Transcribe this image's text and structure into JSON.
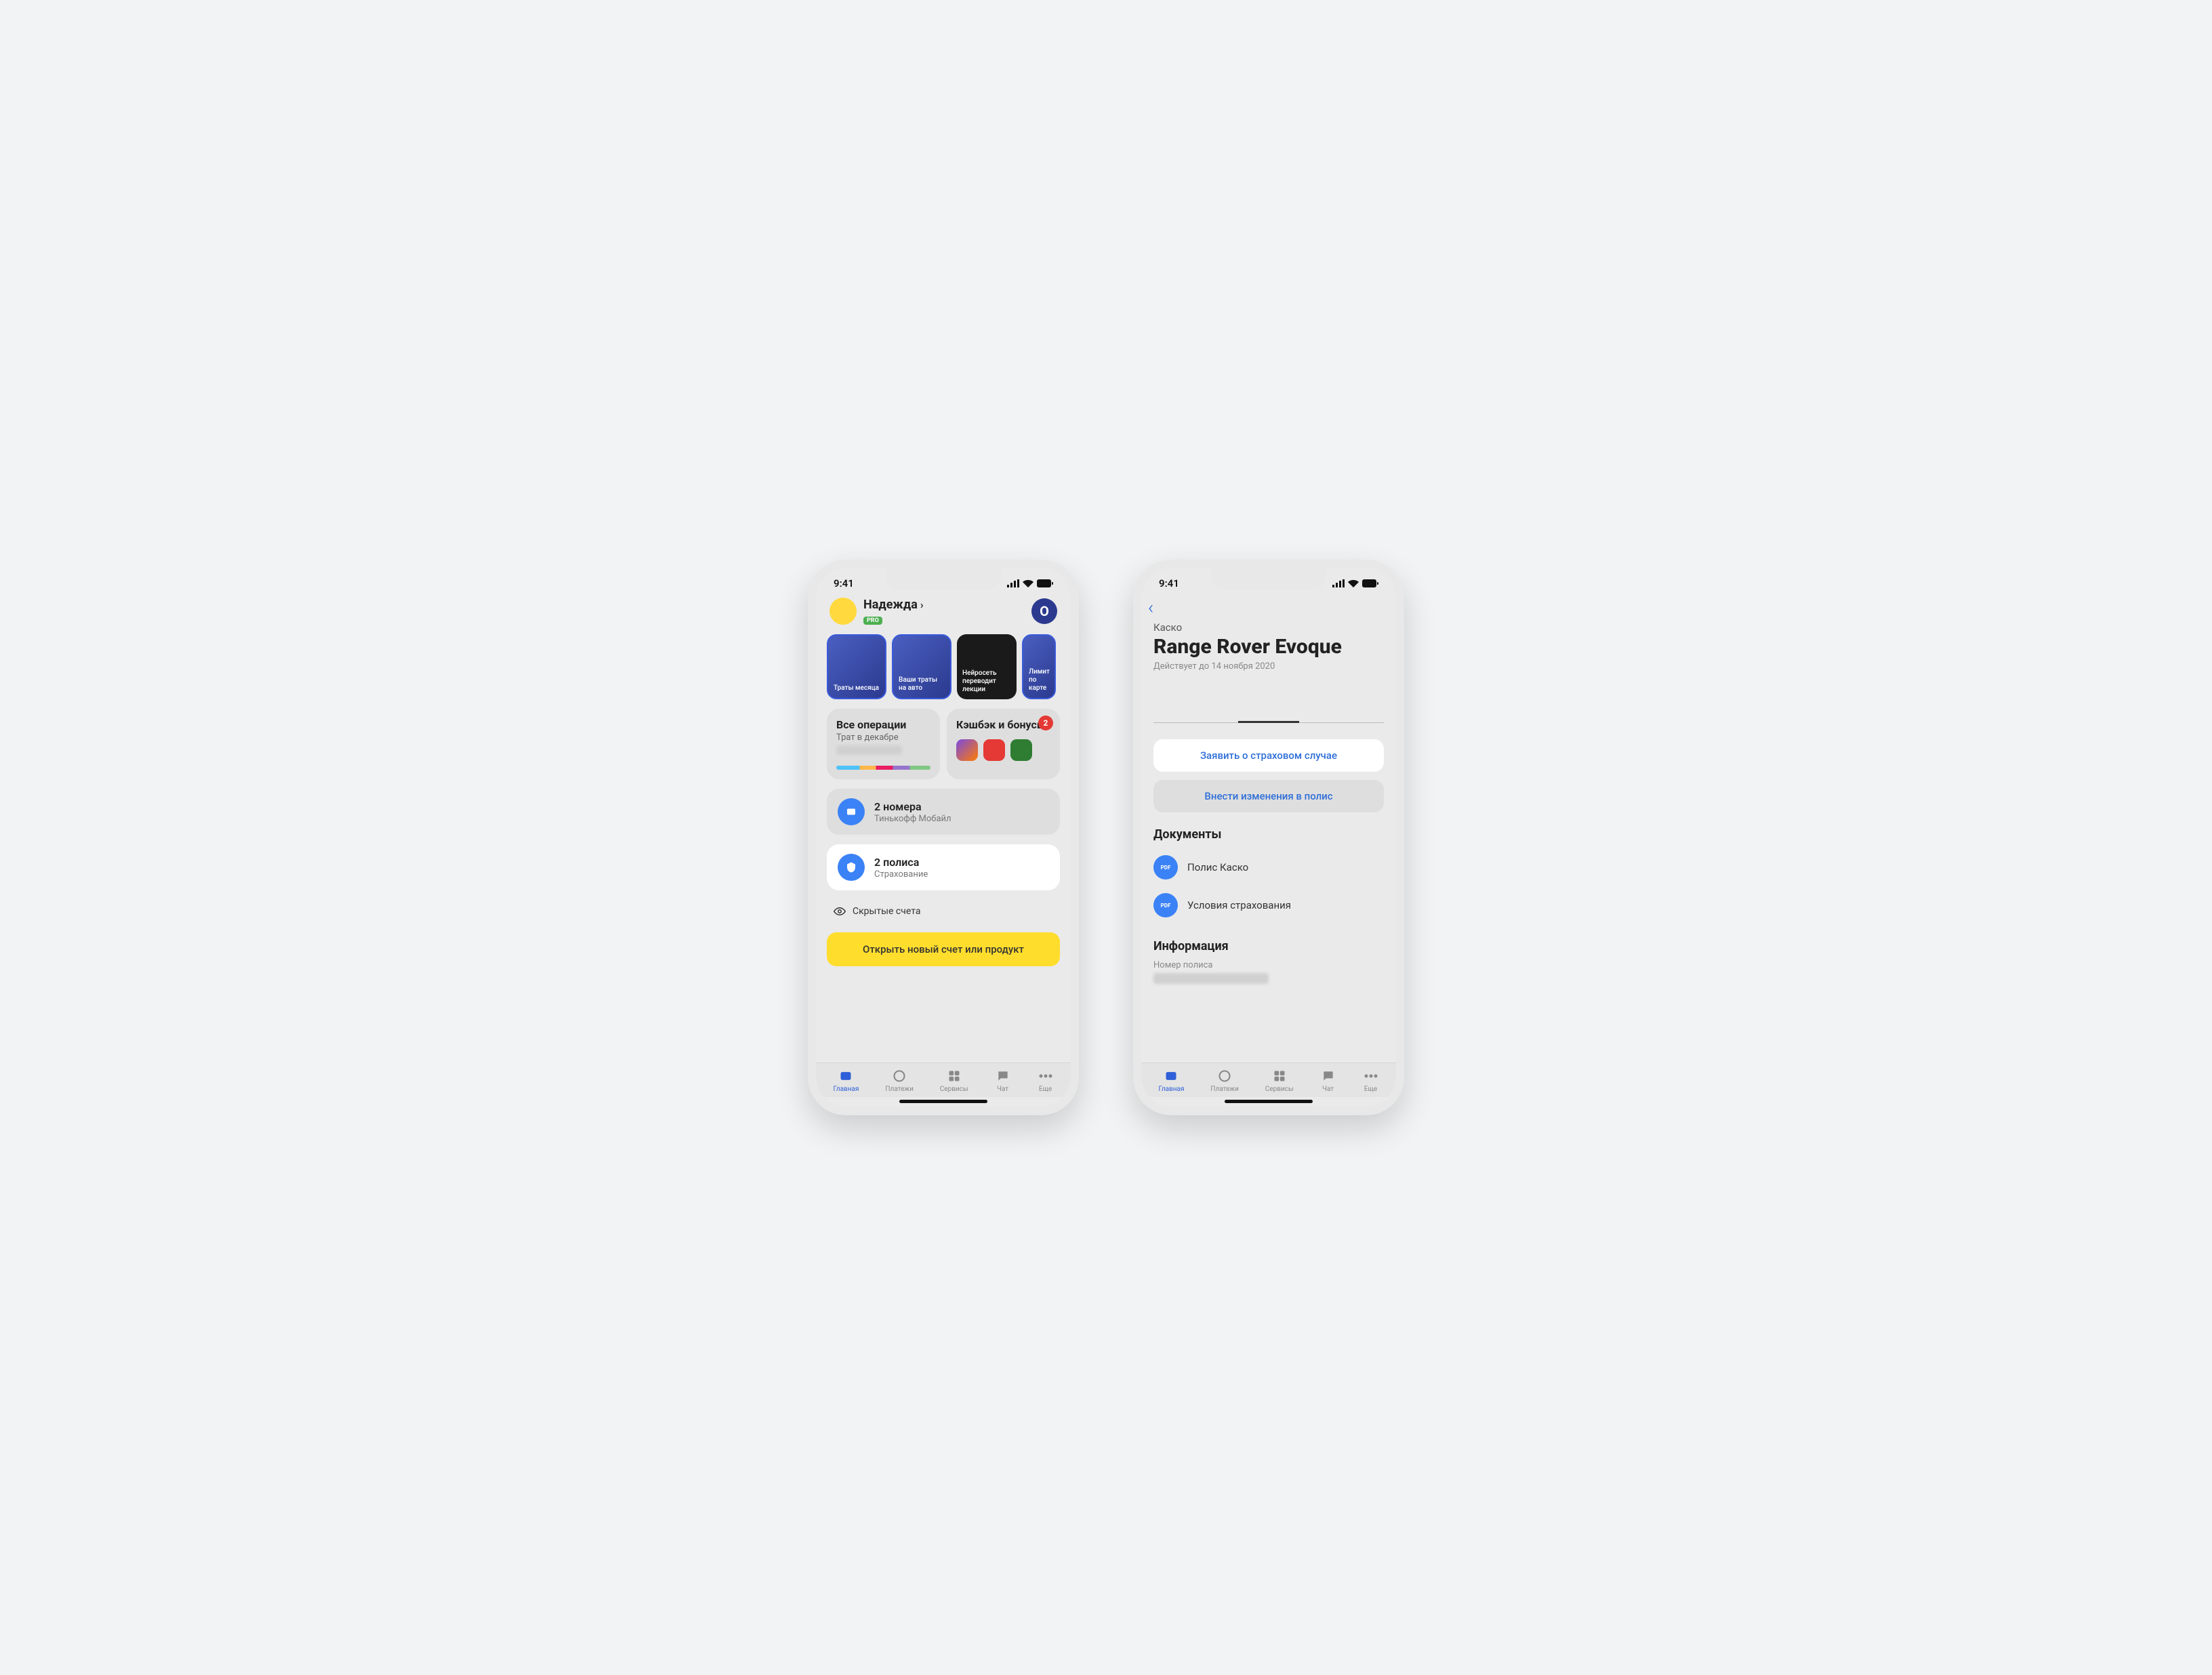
{
  "status_time": "9:41",
  "phone1": {
    "user": {
      "name": "Надежда",
      "badge": "PRO",
      "chevron": "›"
    },
    "logo": "O",
    "stories": [
      {
        "label": "Траты месяца"
      },
      {
        "label": "Ваши траты на авто"
      },
      {
        "label": "Нейросеть переводит лекции"
      },
      {
        "label": "Лимит по карте"
      }
    ],
    "operations": {
      "title": "Все операции",
      "sub": "Трат в декабре"
    },
    "cashback": {
      "title": "Кэшбэк и бонусы",
      "badge": "2"
    },
    "mobile": {
      "title": "2 номера",
      "sub": "Тинькофф Мобайл"
    },
    "insurance": {
      "title": "2 полиса",
      "sub": "Страхование"
    },
    "hidden": "Скрытые счета",
    "open": "Открыть новый счет или продукт"
  },
  "phone2": {
    "label": "Каско",
    "title": "Range Rover Evoque",
    "valid": "Действует до 14 ноября 2020",
    "primary": "Заявить о страховом случае",
    "secondary": "Внести изменения в полис",
    "docs_section": "Документы",
    "doc1": "Полис Каско",
    "doc2": "Условия страхования",
    "info_section": "Информация",
    "info_label": "Номер полиса"
  },
  "tabs": [
    {
      "label": "Главная"
    },
    {
      "label": "Платежи"
    },
    {
      "label": "Сервисы"
    },
    {
      "label": "Чат"
    },
    {
      "label": "Еще"
    }
  ]
}
